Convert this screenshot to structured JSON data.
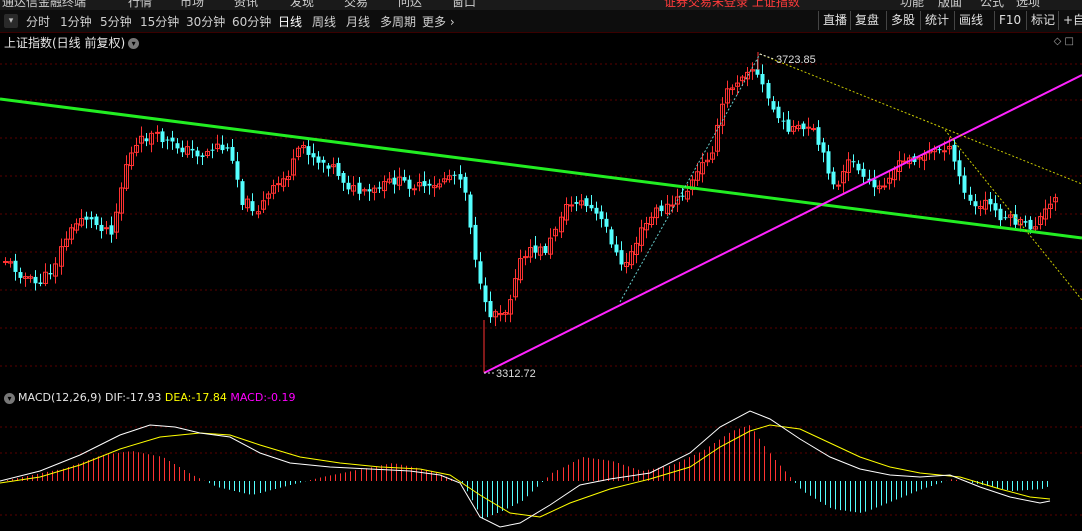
{
  "menubar": {
    "items": [
      "通达信金融终端",
      "行情",
      "市场",
      "资讯",
      "发现",
      "交易",
      "问达",
      "窗口",
      "功能",
      "版面",
      "公式",
      "选项"
    ],
    "notice": "证券交易未登录 上证指数"
  },
  "toolbar": {
    "periods": [
      "分时",
      "1分钟",
      "5分钟",
      "15分钟",
      "30分钟",
      "60分钟",
      "日线",
      "周线",
      "月线",
      "多周期",
      "更多 ›"
    ],
    "active_period": "日线",
    "right_buttons": [
      "直播",
      "复盘",
      "多股",
      "统计",
      "画线",
      "F10",
      "标记",
      "+自"
    ]
  },
  "chart_title": "上证指数(日线 前复权)",
  "annotations": {
    "high": "3723.85",
    "low": "3312.72"
  },
  "macd": {
    "label": "MACD(12,26,9)",
    "dif_label": "DIF:",
    "dif": "-17.93",
    "dea_label": "DEA:",
    "dea": "-17.84",
    "macd_label": "MACD:",
    "macd": "-0.19"
  },
  "colors": {
    "up": "#ff3232",
    "down": "#54ffff",
    "trend_green": "#22ee22",
    "trend_magenta": "#ff22ff",
    "dea": "#ffff00",
    "dif": "#ffffff",
    "grid": "#5a0000"
  },
  "chart_data": {
    "type": "candlestick",
    "high_value": 3723.85,
    "low_value": 3312.72
  }
}
